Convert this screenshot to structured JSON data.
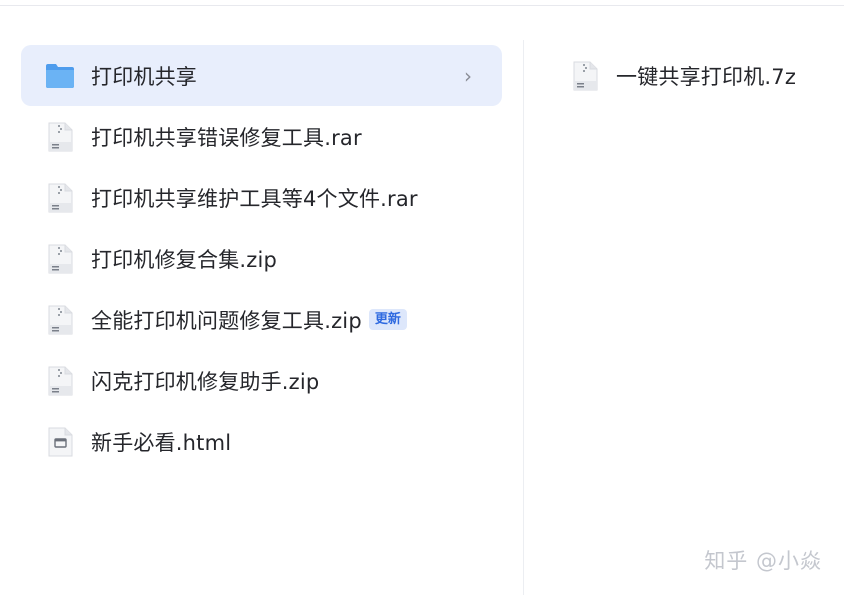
{
  "left_list": {
    "items": [
      {
        "label": "打印机共享",
        "icon": "folder-icon",
        "selected": true,
        "chevron": "›"
      },
      {
        "label": "打印机共享错误修复工具.rar",
        "icon": "archive-file-icon"
      },
      {
        "label": "打印机共享维护工具等4个文件.rar",
        "icon": "archive-file-icon"
      },
      {
        "label": "打印机修复合集.zip",
        "icon": "archive-file-icon"
      },
      {
        "label": "全能打印机问题修复工具.zip",
        "icon": "archive-file-icon",
        "badge": "更新"
      },
      {
        "label": "闪克打印机修复助手.zip",
        "icon": "archive-file-icon"
      },
      {
        "label": "新手必看.html",
        "icon": "html-file-icon"
      }
    ]
  },
  "right_list": {
    "items": [
      {
        "label": "一键共享打印机.7z",
        "icon": "archive-file-icon"
      }
    ]
  },
  "watermark": "知乎 @小焱",
  "colors": {
    "selected_bg": "#e8eefc",
    "folder": "#5aa6ef",
    "badge_bg": "#dde7fb",
    "badge_text": "#2f6ae0"
  }
}
